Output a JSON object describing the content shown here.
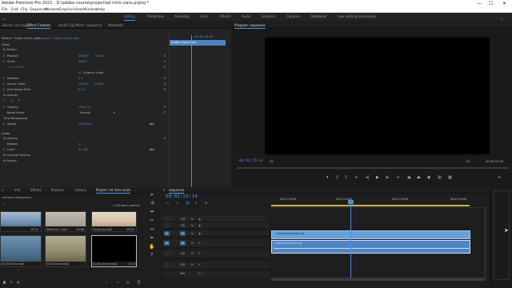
{
  "window": {
    "title": "Adobe Premiere Pro 2021 - D:\\adobe course\\project\\ed intro class.prproj *",
    "minimize": "—",
    "maximize": "☐",
    "close": "✕"
  },
  "menu": [
    "File",
    "Edit",
    "Clip",
    "Sequence",
    "Markers",
    "Graphics",
    "View",
    "Window",
    "Help"
  ],
  "workspaces": [
    "Editing",
    "Productive",
    "Assembly",
    "Color",
    "Effects",
    "Audio",
    "Graphics",
    "Captions",
    "Notebook",
    "new working workspace"
  ],
  "active_workspace": "Editing",
  "effect_controls": {
    "tabs": [
      "Source: (no clips)",
      "Effect Controls",
      "Audio Clip Mixer: sequence",
      "Metadata"
    ],
    "active_tab": "Effect Controls",
    "source_line": "Master * Audio check.mp4",
    "sequence_line": "sequence * Audio check.mp4",
    "clip_timecode": "00:00:00:00",
    "clip_name": "Audio check.mp4",
    "sections": {
      "video": "Video",
      "motion": "fx  Motion",
      "opacity": "fx  Opacity",
      "time_remap": "Time Remapping",
      "audio": "Audio",
      "volume": "fx  Volume",
      "channel_volume": "fx  Channel Volume",
      "panner": "fx  Panner"
    },
    "props": {
      "position_label": "Position",
      "position_x": "2698.0",
      "position_y": "1080.0",
      "scale_label": "Scale",
      "scale_val": "100.0",
      "scale_width_label": "Scale Width",
      "uniform_scale_label": "Uniform Scale",
      "rotation_label": "Rotation",
      "rotation_val": "0.0",
      "anchor_label": "Anchor Point",
      "anchor_x": "1920.0",
      "anchor_y": "1080.0",
      "antiflicker_label": "Anti-flicker Filter",
      "antiflicker_val": "0.00",
      "opacity_label": "Opacity",
      "opacity_val": "100.0 %",
      "blend_label": "Blend Mode",
      "blend_val": "Normal",
      "speed_label": "Speed",
      "speed_val": "100.00%",
      "bypass_label": "Bypass",
      "level_label": "Level",
      "level_val": "0.0 dB"
    },
    "bottom_timecode": "00:02:55:14"
  },
  "program_monitor": {
    "title": "Program: sequence",
    "timecode": "00:02:55:14",
    "fit": "Fit",
    "quality": "1/2",
    "duration": "00:05:02:26"
  },
  "project_panel": {
    "tabs": [
      "Project: ed intro class",
      "Info",
      "Effects",
      "Markers",
      "History"
    ],
    "active_tab": "Project: ed intro class",
    "file_name": "ed intro class.prproj",
    "items_count": "1 of 8 items selected",
    "items": [
      {
        "name": "",
        "duration": "",
        "color": "#6f8fb2"
      },
      {
        "name": "Meeting 1.mp4",
        "duration": "15:08",
        "color": "#a9a39a"
      },
      {
        "name": "Flying by.mp4",
        "duration": "19:20",
        "color": "#d7c2a8"
      },
      {
        "name": "",
        "duration": "",
        "color": "#4b6f8a"
      },
      {
        "name": "",
        "duration": "",
        "color": "#8e8a6b"
      },
      {
        "name": "Audio check.mp4",
        "duration": "17:17",
        "color": "#000000"
      }
    ],
    "item_durations_top": [
      "15:22",
      "",
      ""
    ],
    "item_names_bottom": [
      "00:00 intro.mp4",
      "00:00 intro.mp4",
      "Audio check.mp4"
    ]
  },
  "timeline": {
    "sequence_tab": "sequence",
    "timecode": "00:02:55:14",
    "ruler_labels": [
      "00:01:30:00",
      "00:02:00:00",
      "00:02:30:00",
      "00:03:00:00"
    ],
    "tracks": [
      {
        "name": "V3",
        "target": "V3",
        "btns": [
          "fx",
          "◉"
        ]
      },
      {
        "name": "V2",
        "target": "V2",
        "btns": [
          "fx",
          "◉"
        ]
      },
      {
        "name": "V1",
        "target": "V1",
        "btns": [
          "fx",
          "◉"
        ]
      },
      {
        "name": "A1",
        "target": "A1",
        "btns": [
          "M",
          "S"
        ]
      },
      {
        "name": "A2",
        "target": "A2",
        "btns": [
          "M",
          "S"
        ]
      },
      {
        "name": "A3",
        "target": "A3",
        "btns": [
          "M",
          "S"
        ]
      }
    ],
    "master_label": "Mix",
    "master_value": "0.0",
    "video_clip_label": "Audio check.mp4 [V]",
    "audio_clip_label": "Audio check.mp4 [A]"
  },
  "colors": {
    "accent_blue": "#4d8fe0",
    "clip_video": "#6a9fd8",
    "clip_audio": "#4e84c4",
    "playhead": "#4d8fe0",
    "work_area": "#d1b24a"
  }
}
